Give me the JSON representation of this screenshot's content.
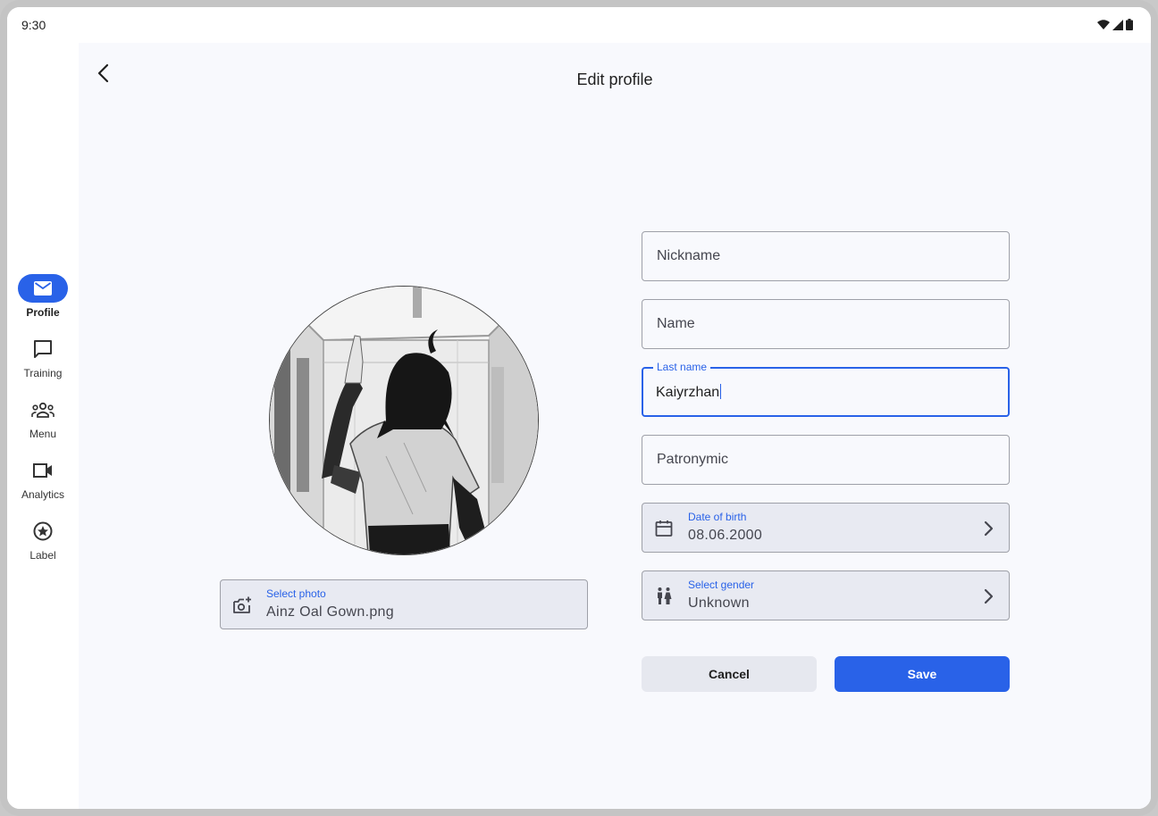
{
  "status_bar": {
    "time": "9:30"
  },
  "nav_rail": {
    "items": [
      {
        "label": "Profile",
        "icon": "mail-icon",
        "active": true
      },
      {
        "label": "Training",
        "icon": "chat-icon",
        "active": false
      },
      {
        "label": "Menu",
        "icon": "group-icon",
        "active": false
      },
      {
        "label": "Analytics",
        "icon": "videocam-icon",
        "active": false
      },
      {
        "label": "Label",
        "icon": "star-circle-icon",
        "active": false
      }
    ]
  },
  "header": {
    "title": "Edit profile"
  },
  "photo": {
    "label": "Select photo",
    "value": "Ainz Oal Gown.png"
  },
  "form": {
    "nickname": {
      "placeholder": "Nickname"
    },
    "name": {
      "placeholder": "Name"
    },
    "last_name": {
      "label": "Last name",
      "value": "Kaiyrzhan"
    },
    "patronymic": {
      "placeholder": "Patronymic"
    },
    "birth": {
      "label": "Date of birth",
      "value": "08.06.2000"
    },
    "gender": {
      "label": "Select gender",
      "value": "Unknown"
    }
  },
  "actions": {
    "cancel": "Cancel",
    "save": "Save"
  },
  "colors": {
    "accent": "#2962e8",
    "background": "#f8f9fd",
    "filled_field": "#e8eaf2",
    "cancel_bg": "#e6e8ef"
  }
}
